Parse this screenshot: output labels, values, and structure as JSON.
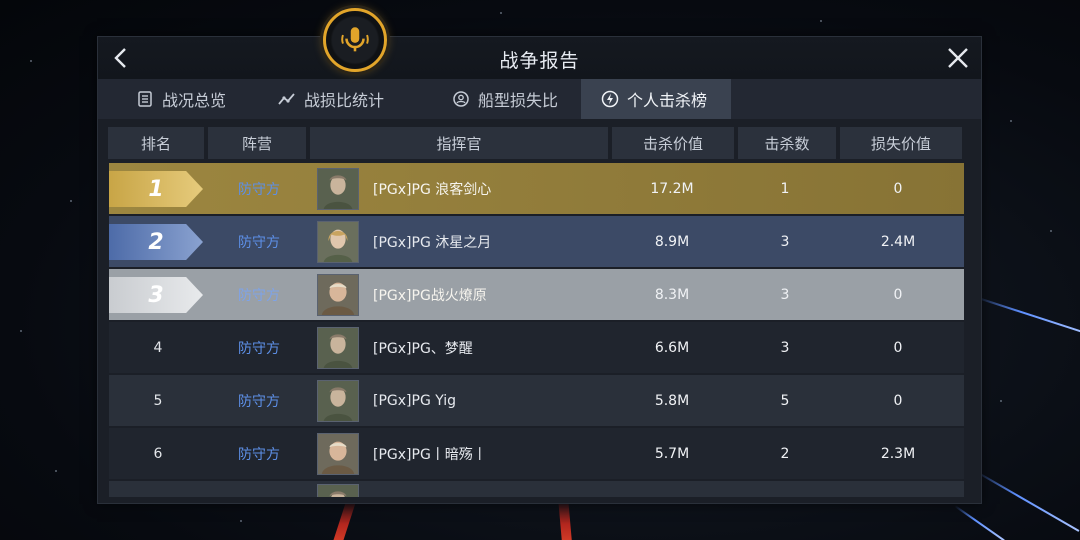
{
  "header": {
    "title": "战争报告"
  },
  "tabs": [
    {
      "label": "战况总览",
      "icon": "list-icon"
    },
    {
      "label": "战损比统计",
      "icon": "line-chart-icon"
    },
    {
      "label": "船型损失比",
      "icon": "ship-icon"
    },
    {
      "label": "个人击杀榜",
      "icon": "lightning-icon",
      "active": true
    }
  ],
  "table": {
    "columns": [
      "排名",
      "阵营",
      "指挥官",
      "击杀价值",
      "击杀数",
      "损失价值"
    ],
    "rows": [
      {
        "rank": "1",
        "faction": "防守方",
        "commander": "[PGx]PG 浪客剑心",
        "kill_value": "17.2M",
        "kills": "1",
        "loss_value": "0"
      },
      {
        "rank": "2",
        "faction": "防守方",
        "commander": "[PGx]PG 沐星之月",
        "kill_value": "8.9M",
        "kills": "3",
        "loss_value": "2.4M"
      },
      {
        "rank": "3",
        "faction": "防守方",
        "commander": "[PGx]PG战火燎原",
        "kill_value": "8.3M",
        "kills": "3",
        "loss_value": "0"
      },
      {
        "rank": "4",
        "faction": "防守方",
        "commander": "[PGx]PG、梦醒",
        "kill_value": "6.6M",
        "kills": "3",
        "loss_value": "0"
      },
      {
        "rank": "5",
        "faction": "防守方",
        "commander": "[PGx]PG Yig",
        "kill_value": "5.8M",
        "kills": "5",
        "loss_value": "0"
      },
      {
        "rank": "6",
        "faction": "防守方",
        "commander": "[PGx]PG丨暗殇丨",
        "kill_value": "5.7M",
        "kills": "2",
        "loss_value": "2.3M"
      }
    ]
  }
}
